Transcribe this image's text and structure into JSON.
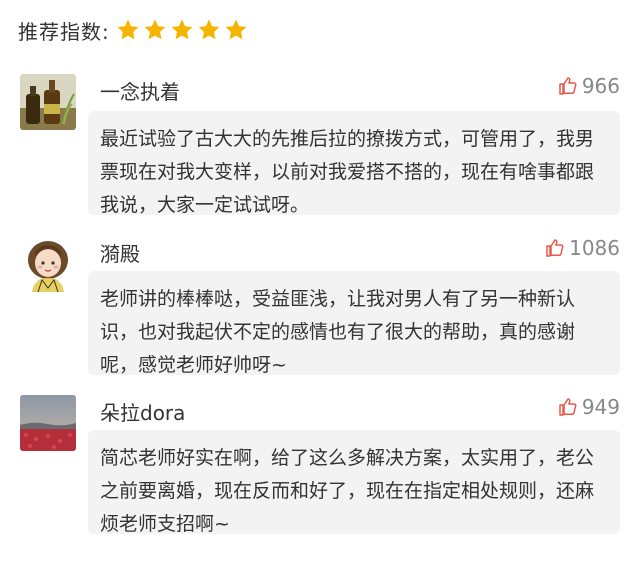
{
  "rating": {
    "label": "推荐指数:",
    "stars": 5,
    "star_color": "#f5b400"
  },
  "comments": [
    {
      "username": "一念执着",
      "likes": "966",
      "text": "最近试验了古大大的先推后拉的撩拨方式，可管用了，我男票现在对我大变样，以前对我爱搭不搭的，现在有啥事都跟我说，大家一定试试呀。",
      "avatar": "avatar-bottles-photo"
    },
    {
      "username": "漪殿",
      "likes": "1086",
      "text": "老师讲的棒棒哒，受益匪浅，让我对男人有了另一种新认识，也对我起伏不定的感情也有了很大的帮助，真的感谢呢，感觉老师好帅呀~",
      "avatar": "avatar-cartoon-girl"
    },
    {
      "username": "朵拉dora",
      "likes": "949",
      "text": "简芯老师好实在啊，给了这么多解决方案，太实用了，老公之前要离婚，现在反而和好了，现在在指定相处规则，还麻烦老师支招啊~",
      "avatar": "avatar-flower-field-photo"
    }
  ],
  "colors": {
    "like_icon": "#e8574a",
    "bubble_bg": "#f3f3f3",
    "text": "#333333",
    "muted": "#888888"
  }
}
